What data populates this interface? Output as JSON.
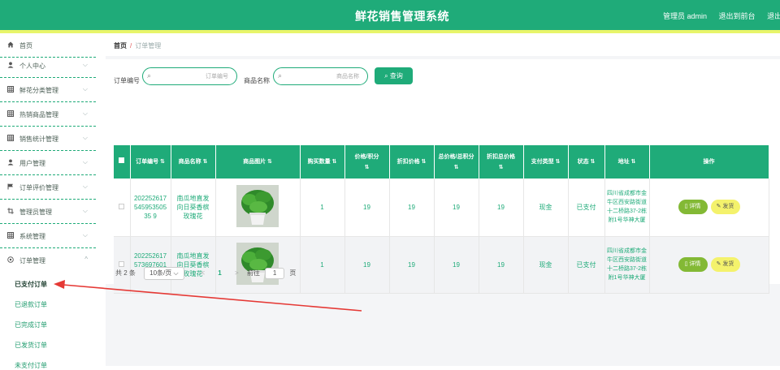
{
  "header": {
    "title": "鲜花销售管理系统",
    "admin": "管理员 admin",
    "to_frontend": "退出到前台",
    "logout": "退出登"
  },
  "sidebar": {
    "items": [
      {
        "label": "首页",
        "icon": "home-icon"
      },
      {
        "label": "个人中心",
        "icon": "user-icon"
      },
      {
        "label": "鲜花分类管理",
        "icon": "grid-icon"
      },
      {
        "label": "热销商品管理",
        "icon": "grid-icon"
      },
      {
        "label": "销售统计管理",
        "icon": "grid-icon"
      },
      {
        "label": "用户管理",
        "icon": "user-icon"
      },
      {
        "label": "订单评价管理",
        "icon": "flag-icon"
      },
      {
        "label": "管理员管理",
        "icon": "crop-icon"
      },
      {
        "label": "系统管理",
        "icon": "grid-icon"
      },
      {
        "label": "订单管理",
        "icon": "settings-icon"
      }
    ],
    "sub_items": [
      "已支付订单",
      "已退款订单",
      "已完成订单",
      "已发货订单",
      "未支付订单"
    ]
  },
  "breadcrumb": {
    "home": "首页",
    "separator": "/",
    "current": "订单管理"
  },
  "search": {
    "order_no_label": "订单编号",
    "order_no_placeholder": "订单编号",
    "product_name_label": "商品名称",
    "product_name_placeholder": "商品名称",
    "query_button": "查询"
  },
  "table": {
    "columns": [
      "订单编号",
      "商品名称",
      "商品图片",
      "购买数量",
      "价格/积分",
      "折扣价格",
      "总价格/总积分",
      "折扣总价格",
      "支付类型",
      "状态",
      "地址",
      "操作"
    ],
    "rows": [
      {
        "order_no": "20225261754595350535 9",
        "product_name": "南瓜地直发向日葵香槟玫瑰花",
        "quantity": "1",
        "price": "19",
        "discount_price": "19",
        "total": "19",
        "discount_total": "19",
        "pay_type": "现金",
        "status": "已支付",
        "address": "四川省成都市金牛区西安路街道十二桥路37-2栋附1号华神大厦",
        "detail_btn": "详情",
        "edit_btn": "发货"
      },
      {
        "order_no": "20225261757369760117 3",
        "product_name": "南瓜地直发向日葵香槟玫瑰花",
        "quantity": "1",
        "price": "19",
        "discount_price": "19",
        "total": "19",
        "discount_total": "19",
        "pay_type": "现金",
        "status": "已支付",
        "address": "四川省成都市金牛区西安路街道十二桥路37-2栋附1号华神大厦",
        "detail_btn": "详情",
        "edit_btn": "发货"
      }
    ]
  },
  "pager": {
    "total": "共 2 条",
    "page_size": "10条/页",
    "prev": "<",
    "current": "1",
    "next": ">",
    "goto_label": "前往",
    "goto_value": "1",
    "page_unit": "页"
  },
  "colors": {
    "primary": "#1fab79",
    "accent_line": "#e8f56a",
    "annotation_arrow": "#e53935"
  }
}
